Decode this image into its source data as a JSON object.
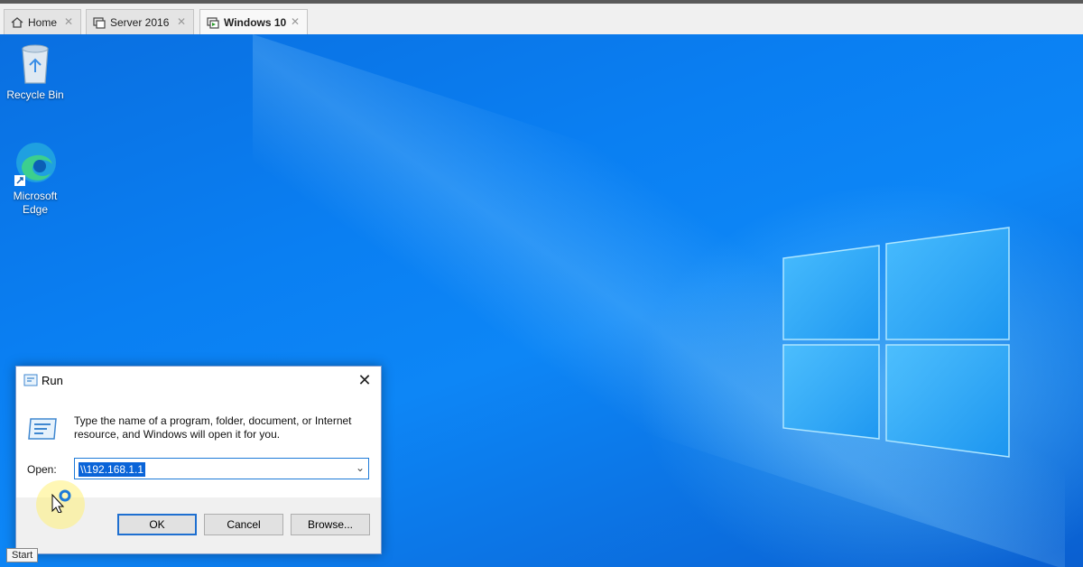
{
  "tabs": [
    {
      "label": "Home",
      "icon": "home-icon",
      "active": false
    },
    {
      "label": "Server 2016",
      "icon": "vm-icon",
      "active": false
    },
    {
      "label": "Windows 10",
      "icon": "vm-icon",
      "active": true
    }
  ],
  "desktop": {
    "icons": [
      {
        "label": "Recycle Bin",
        "icon": "recycle-bin-icon"
      },
      {
        "label": "Microsoft Edge",
        "icon": "edge-icon"
      }
    ]
  },
  "run_dialog": {
    "title": "Run",
    "description": "Type the name of a program, folder, document, or Internet resource, and Windows will open it for you.",
    "open_label": "Open:",
    "open_value": "\\\\192.168.1.1",
    "ok_label": "OK",
    "cancel_label": "Cancel",
    "browse_label": "Browse..."
  },
  "tooltip": "Start",
  "colors": {
    "desktop_blue": "#0a7ff2",
    "selection": "#0a64d8"
  }
}
